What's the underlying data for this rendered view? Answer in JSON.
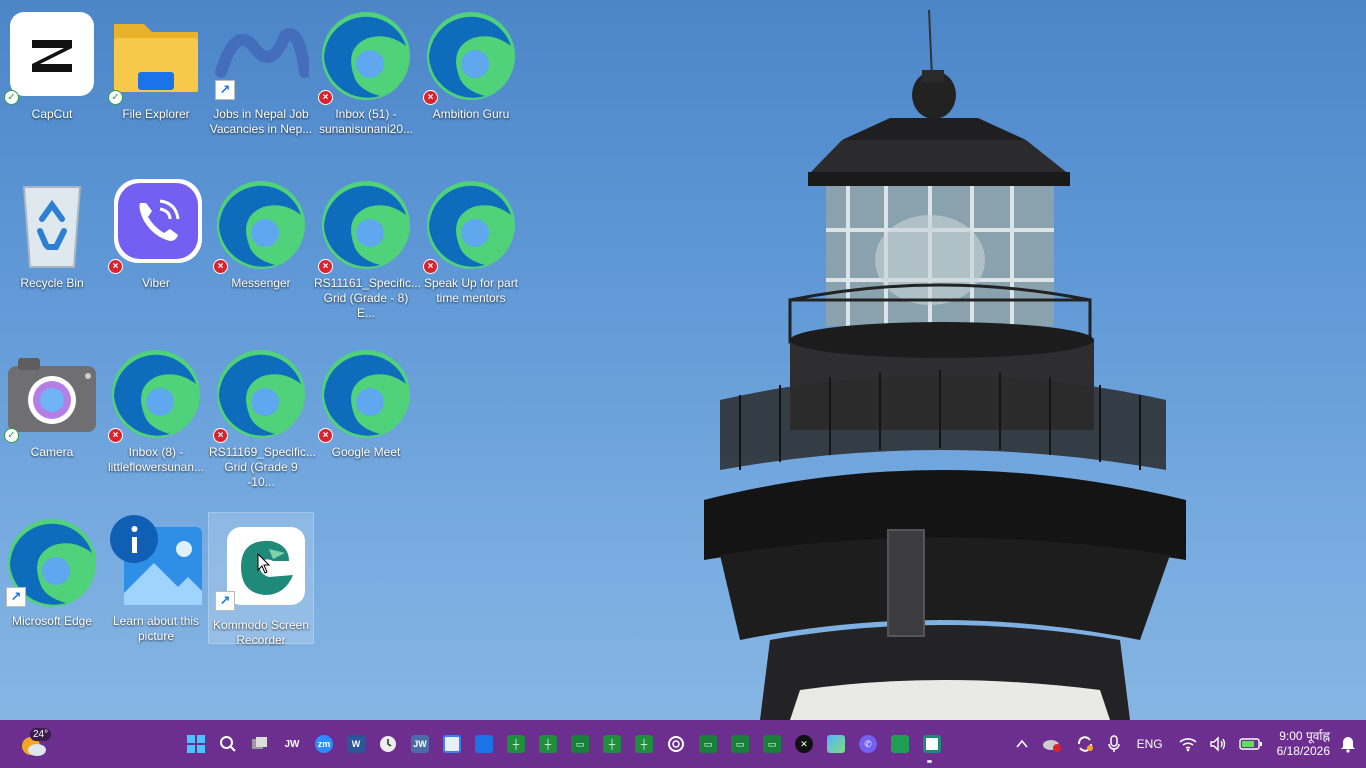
{
  "desktop": {
    "icons": [
      {
        "id": "capcut",
        "label": "CapCut",
        "status": "ok"
      },
      {
        "id": "file-explorer",
        "label": "File Explorer",
        "status": "ok"
      },
      {
        "id": "jobs-nepal",
        "label": "Jobs in Nepal  Job Vacancies in Nep...",
        "status": "shortcut"
      },
      {
        "id": "inbox-51",
        "label": "Inbox (51) - sunanisunani20...",
        "status": "error"
      },
      {
        "id": "ambition-guru",
        "label": "Ambition Guru",
        "status": "error"
      },
      {
        "id": "recycle-bin",
        "label": "Recycle Bin",
        "status": "none"
      },
      {
        "id": "viber",
        "label": "Viber",
        "status": "error"
      },
      {
        "id": "messenger",
        "label": "Messenger",
        "status": "error"
      },
      {
        "id": "rs11161",
        "label": "RS11161_Specific... Grid (Grade - 8) E...",
        "status": "error"
      },
      {
        "id": "speak-up",
        "label": "Speak Up for part time mentors",
        "status": "error"
      },
      {
        "id": "camera",
        "label": "Camera",
        "status": "ok"
      },
      {
        "id": "inbox-8",
        "label": "Inbox (8) - littleflowersunan...",
        "status": "error"
      },
      {
        "id": "rs11169",
        "label": "RS11169_Specific... Grid (Grade 9 -10...",
        "status": "error"
      },
      {
        "id": "google-meet",
        "label": "Google Meet",
        "status": "error"
      },
      {
        "id": "microsoft-edge",
        "label": "Microsoft Edge",
        "status": "shortcut"
      },
      {
        "id": "learn-picture",
        "label": "Learn about this picture",
        "status": "none"
      },
      {
        "id": "kommodo",
        "label": "Kommodo Screen Recorder",
        "status": "shortcut"
      }
    ]
  },
  "taskbar": {
    "weather_temp": "24°",
    "apps": [
      {
        "name": "start-button",
        "icon": "windows-logo-icon"
      },
      {
        "name": "search-button",
        "icon": "search-icon"
      },
      {
        "name": "task-view-button",
        "icon": "task-view-icon"
      },
      {
        "name": "jw-app-1",
        "icon": "jw-icon",
        "text": "JW"
      },
      {
        "name": "zoom-app",
        "icon": "zoom-icon",
        "text": "zm"
      },
      {
        "name": "word-app",
        "icon": "word-icon",
        "text": "W"
      },
      {
        "name": "clock-app",
        "icon": "clock-icon"
      },
      {
        "name": "jw-app-2",
        "icon": "jw-library-icon",
        "text": "JW"
      },
      {
        "name": "notepad-app",
        "icon": "notepad-icon"
      },
      {
        "name": "notes-app",
        "icon": "notes-icon"
      },
      {
        "name": "sheets-app-1",
        "icon": "sheets-icon"
      },
      {
        "name": "sheets-app-2",
        "icon": "sheets-icon"
      },
      {
        "name": "slides-app-1",
        "icon": "slides-icon"
      },
      {
        "name": "sheets-app-3",
        "icon": "sheets-icon"
      },
      {
        "name": "sheets-app-4",
        "icon": "sheets-icon"
      },
      {
        "name": "chatgpt-app",
        "icon": "chatgpt-icon"
      },
      {
        "name": "slides-app-2",
        "icon": "slides-icon"
      },
      {
        "name": "slides-app-3",
        "icon": "slides-icon"
      },
      {
        "name": "slides-app-4",
        "icon": "slides-icon"
      },
      {
        "name": "capcut-app",
        "icon": "capcut-icon"
      },
      {
        "name": "photos-app",
        "icon": "photos-icon"
      },
      {
        "name": "viber-app",
        "icon": "viber-icon"
      },
      {
        "name": "green-app",
        "icon": "folder-green-icon"
      },
      {
        "name": "kommodo-app",
        "icon": "kommodo-icon"
      }
    ],
    "tray": {
      "language": "ENG",
      "time": "9:00 पूर्वाह्न",
      "date": "6/18/2026"
    }
  },
  "colors": {
    "taskbar_bg": "#6d2f8f",
    "sheets_green": "#1e8e3e",
    "slides_green": "#188038",
    "edge_blue": "#0f6cbd",
    "edge_green": "#4fd27a"
  }
}
